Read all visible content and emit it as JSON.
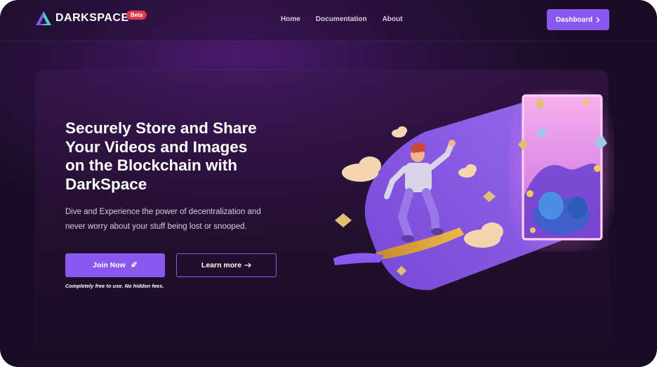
{
  "brand": {
    "name": "DARKSPACE",
    "badge": "Beta",
    "icon": "triangle-logo-icon"
  },
  "nav": {
    "links": [
      {
        "label": "Home"
      },
      {
        "label": "Documentation"
      },
      {
        "label": "About"
      }
    ],
    "dashboard_label": "Dashboard",
    "dashboard_icon": "chevron-right-icon"
  },
  "hero": {
    "headline_lines": [
      "Securely Store and Share",
      "Your Videos and Images",
      "on the Blockchain with",
      "DarkSpace"
    ],
    "subtext_lines": [
      "Dive and Experience the power of decentralization and",
      "never worry about your stuff being lost or snooped."
    ],
    "join_label": "Join Now",
    "join_icon": "rocket-icon",
    "learn_label": "Learn more",
    "learn_icon": "arrow-right-icon",
    "note": "Completely free to use. No hidden fees."
  },
  "colors": {
    "accent": "#8a58f0",
    "badge": "#e0384b",
    "background": "#1a0c24"
  }
}
